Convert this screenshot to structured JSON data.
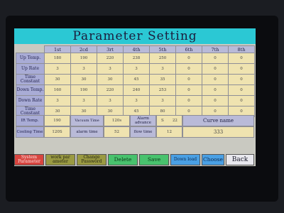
{
  "title": "Parameter Setting",
  "columns": [
    "1st",
    "2cd",
    "3rt",
    "4th",
    "5th",
    "6th",
    "7th",
    "8th"
  ],
  "rows": [
    {
      "label": "Up Temp.",
      "values": [
        "180",
        "190",
        "220",
        "238",
        "250",
        "0",
        "0",
        "0"
      ]
    },
    {
      "label": "Up Rate",
      "values": [
        "3",
        "3",
        "3",
        "3",
        "3",
        "0",
        "0",
        "0"
      ]
    },
    {
      "label": "Time Constant",
      "values": [
        "30",
        "30",
        "30",
        "45",
        "35",
        "0",
        "0",
        "0"
      ]
    },
    {
      "label": "Down Temp.",
      "values": [
        "160",
        "190",
        "220",
        "240",
        "253",
        "0",
        "0",
        "0"
      ]
    },
    {
      "label": "Down Rate",
      "values": [
        "3",
        "3",
        "3",
        "3",
        "3",
        "0",
        "0",
        "0"
      ]
    },
    {
      "label": "Time Constant",
      "values": [
        "30",
        "30",
        "30",
        "45",
        "80",
        "0",
        "0",
        "0"
      ]
    }
  ],
  "lower": {
    "ir_temp_label": "IR Temp.",
    "ir_temp_value": "190",
    "vacuum_time_label": "Vacuum Time",
    "vacuum_time_value": "120s",
    "alarm_advance_label": "Alarm advance",
    "alarm_advance_value": "22",
    "alarm_unit": "S",
    "curve_name_label": "Curve name",
    "cooling_time_label": "Cooling Time",
    "cooling_time_value": "120S",
    "alarm_time_label": "alarm time",
    "alarm_time_value": "52",
    "flow_time_label": "flow time",
    "flow_time_value": "12",
    "curve_name_value": "333"
  },
  "buttons": {
    "system_parameter": "System Parameter",
    "work_parameter": "work par ameter",
    "change_password": "Change Password",
    "delete": "Delete",
    "save": "Save",
    "download": "Down load",
    "choose": "Choose",
    "back": "Back"
  },
  "colors": {
    "title_bar": "#2bc8d4",
    "label_cells": "#a9acd6",
    "value_cells": "#efe3b0",
    "btn_red": "#d8453f",
    "btn_green": "#48c26d",
    "btn_blue": "#4aa0e4"
  }
}
